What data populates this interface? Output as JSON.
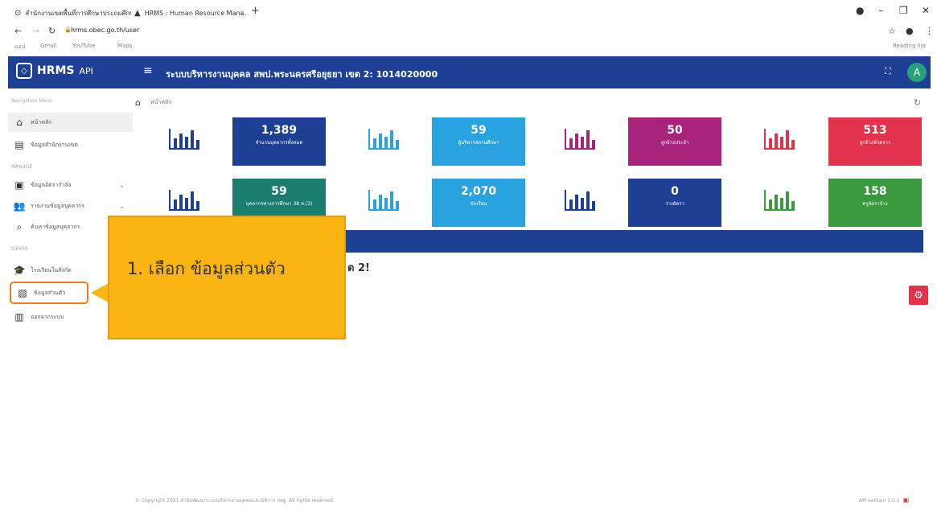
{
  "browser": {
    "tabs": [
      {
        "title": "สำนักงานเขตพื้นที่การศึกษาประถมศึกษา",
        "icon": "globe-icon"
      },
      {
        "title": "HRMS : Human Resource Mana...",
        "icon": "triangle-icon"
      }
    ],
    "url": "hrms.obec.go.th/user",
    "bookmarks": [
      "แอป",
      "Gmail",
      "YouTube",
      "Maps"
    ],
    "reading_list": "Reading list"
  },
  "app": {
    "logo_text": "HRMS",
    "logo_suffix": "API",
    "title": "ระบบบริหารงานบุคคล สพป.พระนครศรีอยุธยา เขต 2: 1014020000",
    "avatar_letter": "A",
    "header_color": "#1d3f94"
  },
  "sidebar": {
    "section_navigation": "Navigation Menu",
    "section_manage": "MANAGE",
    "section_other": "OTHER",
    "items": [
      {
        "label": "หน้าหลัก",
        "icon": "home-icon"
      },
      {
        "label": "ข้อมูลสำนักงานเขต",
        "icon": "building-icon"
      },
      {
        "label": "ข้อมูลอัตรากำลัง",
        "icon": "id-card-icon"
      },
      {
        "label": "รายงานข้อมูลบุคลากร",
        "icon": "users-icon"
      },
      {
        "label": "ค้นหาข้อมูลบุคลากร",
        "icon": "search-icon"
      },
      {
        "label": "โรงเรียนในสังกัด",
        "icon": "graduation-icon"
      },
      {
        "label": "ข้อมูลส่วนตัว",
        "icon": "document-icon"
      },
      {
        "label": "ออกจากระบบ",
        "icon": "door-icon"
      }
    ]
  },
  "breadcrumb": {
    "label": "หน้าหลัก"
  },
  "stats": [
    {
      "value": "1,389",
      "label": "จำนวนบุคลากรทั้งหมด",
      "color": "#1d3f94",
      "icon_color": "#1d3f94"
    },
    {
      "value": "59",
      "label": "ผู้บริหารสถานศึกษา",
      "color": "#29a3e0",
      "icon_color": "#29a3e0"
    },
    {
      "value": "50",
      "label": "ลูกจ้างประจำ",
      "color": "#a8247c",
      "icon_color": "#a8247c"
    },
    {
      "value": "513",
      "label": "ลูกจ้างชั่วคราว",
      "color": "#e3324b",
      "icon_color": "#e3324b"
    },
    {
      "value": "59",
      "label": "บุคลากรทางการศึกษา 38 ค.(2)",
      "color": "#1a7d6e",
      "icon_color": "#1d3f94"
    },
    {
      "value": "2,070",
      "label": "นักเรียน",
      "color": "#29a3e0",
      "icon_color": "#29a3e0"
    },
    {
      "value": "0",
      "label": "ว่างอัตรา",
      "color": "#1d3f94",
      "icon_color": "#1d3f94"
    },
    {
      "value": "158",
      "label": "ครูอัตราจ้าง",
      "color": "#3a9a3e",
      "icon_color": "#3a9a3e"
    }
  ],
  "content": {
    "partial_heading": "ต 2!"
  },
  "callout": {
    "text": "1. เลือก ข้อมูลส่วนตัว"
  },
  "footer": {
    "copyright": "© Copyright 2021 สำนักพัฒนาระบบบริหารงานบุคคลและนิติการ สพฐ. All rights reserved.",
    "version": "API version 1.0.1"
  }
}
